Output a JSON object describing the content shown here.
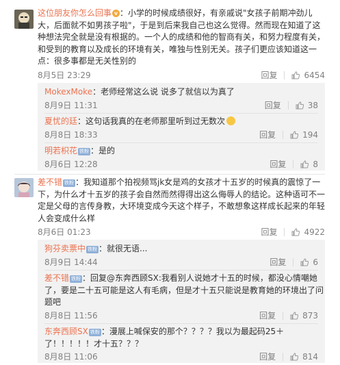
{
  "labels": {
    "reply": "回复"
  },
  "comments": [
    {
      "user": "这位朋友你怎么回事",
      "text": "：小学的时候成绩很好，有亲戚说\"女孩子前期冲劲儿大，后面就不如男孩子啦\"，于是到后来我自己也这么觉得。然而现在知道了这种想法完全就是没有根据的。一个人的成绩和他的智商有关，和努力程度有关，和受到的教育以及成长的环境有关，唯独与性别无关。孩子们更应该知道这一点：很多事都是无关性别的",
      "time": "8月5日 23:29",
      "likes": "6454",
      "replies": [
        {
          "user": "MokexMoke",
          "text": "：老师经常这么说 说多了就信以为真了",
          "time": "8月9日 11:31",
          "likes": "38"
        },
        {
          "user": "夏忧的廷",
          "text": "：这句话我真的在老师那里听到过无数次",
          "time": "8月8日 18:33",
          "likes": "194"
        },
        {
          "user": "明若枳花",
          "level": "铁粉",
          "text": "：是的",
          "time": "8月6日 12:28",
          "likes": "8"
        }
      ]
    },
    {
      "user": "差不错",
      "level": "铁粉",
      "text": "：我知道那个拍视频骂jk女是鸡的女孩才十五岁的时候真的震惊了一下，为什么才十五岁的孩子会自然而然得得出这么侮辱人的结论。这种语可不一定是父母的言传身教，大环境变成今天这个样子，不敢想象这样成长起来的年轻人会变成什么样",
      "time": "8月6日 01:23",
      "likes": "4922",
      "replies": [
        {
          "user": "狗芬卖票中",
          "level": "铁粉",
          "text": "：就很无语...",
          "time": "8月9日 14:44",
          "likes": "6"
        },
        {
          "user": "差不错",
          "level": "铁粉",
          "text": "：回复@东奔西顾SX:我看别人说她才十五的时候，都没心情嘲她了，要是二十五可能是这人有毛病，但是才十五只能说是教育她的环境出了问题吧",
          "time": "8月8日 11:56",
          "likes": "873"
        },
        {
          "user": "东奔西顾SX",
          "level": "铁粉",
          "text": "：漫展上喊保安的那个？？？？我以为最起码25＋了！！！！！才十五？？？",
          "time": "8月8日 11:06",
          "likes": "814"
        }
      ]
    }
  ],
  "colors": {
    "username": "#eb7350",
    "mention": "#3e7fc3",
    "meta": "#808080",
    "subbox": "#f2f2f2"
  },
  "icons": [
    "avatar-cartoon",
    "avatar-anime",
    "v-badge-icon",
    "level-badge",
    "thumb-up-icon",
    "smile-emoji"
  ]
}
